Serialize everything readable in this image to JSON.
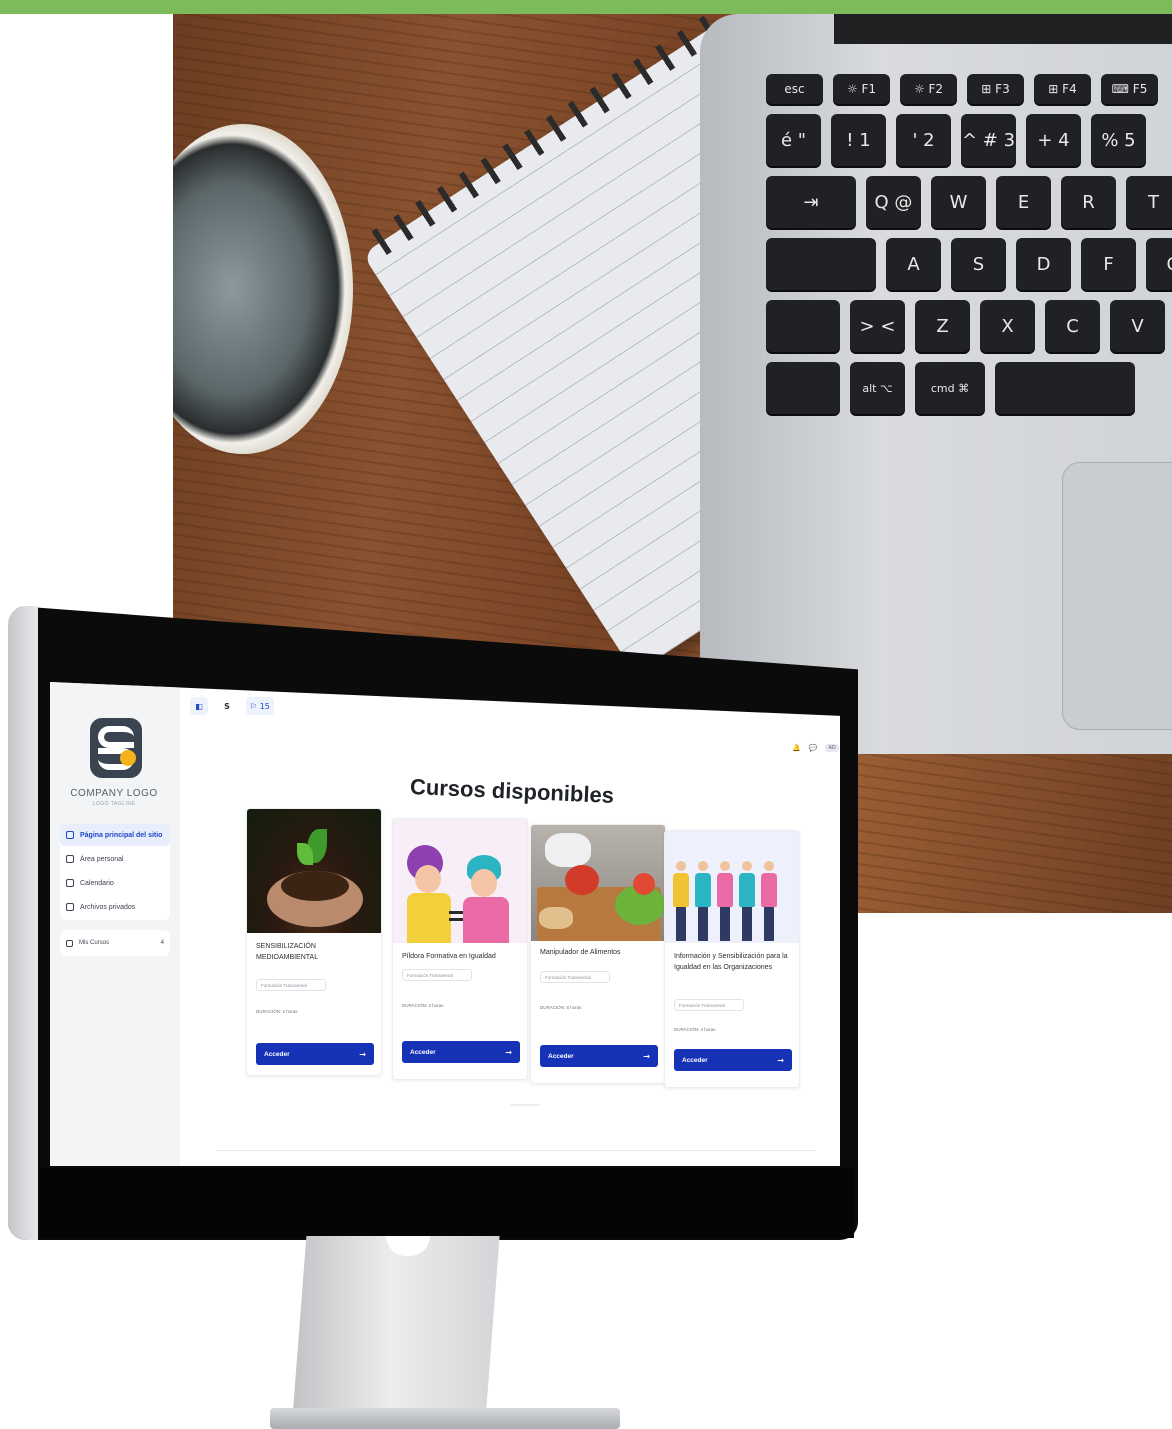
{
  "laptop": {
    "function_keys": [
      "esc",
      "☼ F1",
      "☼ F2",
      "⊞ F3",
      "⊞ F4",
      "⌨ F5"
    ],
    "number_keys": [
      "é\n\"",
      "!\n1",
      "'\n2",
      "^ #\n3",
      "+\n4",
      "%\n5"
    ],
    "q_row": [
      "⇥",
      "Q @",
      "W",
      "E",
      "R",
      "T"
    ],
    "a_row": [
      "",
      "A",
      "S",
      "D",
      "F",
      "G"
    ],
    "z_row": [
      "",
      "> <",
      "Z",
      "X",
      "C",
      "V"
    ],
    "mod_row": [
      "alt ⌥",
      "cmd ⌘"
    ]
  },
  "app": {
    "logo_text": "COMPANY LOGO",
    "logo_tagline": "LOGO TAGLINE",
    "nav": [
      {
        "label": "Página principal del sitio",
        "active": true
      },
      {
        "label": "Área personal",
        "active": false
      },
      {
        "label": "Calendario",
        "active": false
      },
      {
        "label": "Archivos privados",
        "active": false
      }
    ],
    "my_courses": {
      "label": "Mis Cursos",
      "count": "4"
    },
    "topbar": {
      "toggle": "◧",
      "site": "S",
      "flag": "⚐ 15"
    },
    "user_tools": {
      "bell": "🔔",
      "chat": "💬",
      "avatar": "AD"
    },
    "page_title": "Cursos disponibles",
    "courses": [
      {
        "title": "SENSIBILIZACIÓN MEDIOAMBIENTAL",
        "tag": "Formación Transversal",
        "duration": "DURACIÓN: 2 horas",
        "button": "Acceder"
      },
      {
        "title": "Píldora Formativa en Igualdad",
        "tag": "Formación Transversal",
        "duration": "DURACIÓN: 2 horas",
        "button": "Acceder"
      },
      {
        "title": "Manipulador de Alimentos",
        "tag": "Formación Transversal",
        "duration": "DURACIÓN: 8 horas",
        "button": "Acceder"
      },
      {
        "title": "Información y Sensibilización para la Igualdad en las Organizaciones",
        "tag": "Formación Transversal",
        "duration": "DURACIÓN: 4 horas",
        "button": "Acceder"
      }
    ],
    "button_arrow": "→",
    "colors": {
      "accent": "#1633b8",
      "active_nav": "#2146c7",
      "top_band": "#7dbb5a"
    }
  }
}
